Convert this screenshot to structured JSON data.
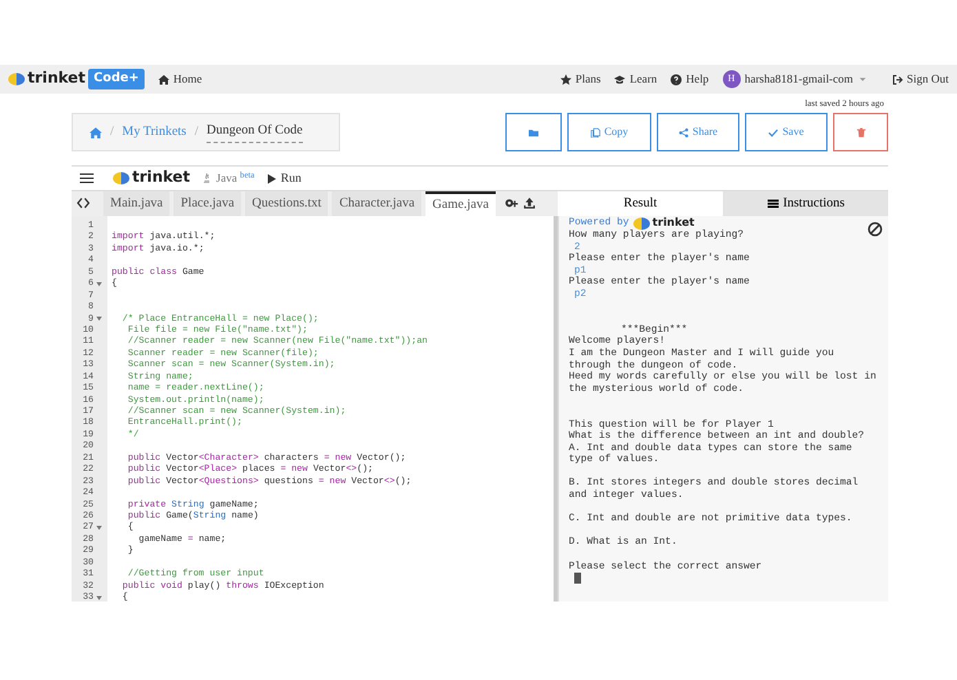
{
  "navbar": {
    "logo": "trinket",
    "badge": "Code+",
    "home": "Home",
    "items": [
      {
        "label": "Plans",
        "kind": "plans"
      },
      {
        "label": "Learn",
        "kind": "learn"
      },
      {
        "label": "Help",
        "kind": "help"
      }
    ],
    "avatar": "H",
    "user": "harsha8181-gmail-com",
    "signout": "Sign Out"
  },
  "saved": "last saved 2 hours ago",
  "breadcrumb": {
    "separators": [
      "/",
      "/"
    ],
    "link": "My Trinkets",
    "current": "Dungeon Of Code"
  },
  "actions": [
    {
      "kind": "folder"
    },
    {
      "kind": "copy",
      "label": "Copy"
    },
    {
      "kind": "share",
      "label": "Share"
    },
    {
      "kind": "save",
      "label": "Save"
    },
    {
      "kind": "delete"
    }
  ],
  "toolbar": {
    "logo": "trinket",
    "language": "Java",
    "tag": "beta",
    "run": "Run"
  },
  "files": [
    {
      "label": "Main.java",
      "selected": false
    },
    {
      "label": "Place.java",
      "selected": false
    },
    {
      "label": "Questions.txt",
      "selected": false
    },
    {
      "label": "Character.java",
      "selected": false
    },
    {
      "label": "Game.java",
      "selected": true
    }
  ],
  "panes": [
    {
      "label": "Result",
      "selected": true,
      "kind": "result"
    },
    {
      "label": "Instructions",
      "selected": false,
      "kind": "instructions"
    }
  ],
  "code": [
    {
      "n": "1",
      "fold": false
    },
    {
      "n": "2",
      "fold": false,
      "tokens": [
        {
          "kind": "keyword",
          "t": "import"
        },
        {
          "kind": "plain",
          "t": " java.util.*;"
        }
      ]
    },
    {
      "n": "3",
      "fold": false,
      "tokens": [
        {
          "kind": "keyword",
          "t": "import"
        },
        {
          "kind": "plain",
          "t": " java.io.*;"
        }
      ]
    },
    {
      "n": "4",
      "fold": false
    },
    {
      "n": "5",
      "fold": false,
      "tokens": [
        {
          "kind": "keyword",
          "t": "public class"
        },
        {
          "kind": "plain",
          "t": " Game"
        }
      ]
    },
    {
      "n": "6",
      "fold": true,
      "tokens": [
        {
          "kind": "plain",
          "t": "{"
        }
      ]
    },
    {
      "n": "7",
      "fold": false
    },
    {
      "n": "8",
      "fold": false
    },
    {
      "n": "9",
      "fold": true,
      "tokens": [
        {
          "kind": "comment",
          "t": "  /* Place EntranceHall = new Place();"
        }
      ]
    },
    {
      "n": "10",
      "fold": false,
      "tokens": [
        {
          "kind": "comment",
          "t": "   File file = new File(\"name.txt\");"
        }
      ]
    },
    {
      "n": "11",
      "fold": false,
      "tokens": [
        {
          "kind": "comment",
          "t": "   //Scanner reader = new Scanner(new File(\"name.txt\"));an"
        }
      ]
    },
    {
      "n": "12",
      "fold": false,
      "tokens": [
        {
          "kind": "comment",
          "t": "   Scanner reader = new Scanner(file);"
        }
      ]
    },
    {
      "n": "13",
      "fold": false,
      "tokens": [
        {
          "kind": "comment",
          "t": "   Scanner scan = new Scanner(System.in);"
        }
      ]
    },
    {
      "n": "14",
      "fold": false,
      "tokens": [
        {
          "kind": "comment",
          "t": "   String name;"
        }
      ]
    },
    {
      "n": "15",
      "fold": false,
      "tokens": [
        {
          "kind": "comment",
          "t": "   name = reader.nextLine();"
        }
      ]
    },
    {
      "n": "16",
      "fold": false,
      "tokens": [
        {
          "kind": "comment",
          "t": "   System.out.println(name);"
        }
      ]
    },
    {
      "n": "17",
      "fold": false,
      "tokens": [
        {
          "kind": "comment",
          "t": "   //Scanner scan = new Scanner(System.in);"
        }
      ]
    },
    {
      "n": "18",
      "fold": false,
      "tokens": [
        {
          "kind": "comment",
          "t": "   EntranceHall.print();"
        }
      ]
    },
    {
      "n": "19",
      "fold": false,
      "tokens": [
        {
          "kind": "comment",
          "t": "   */"
        }
      ]
    },
    {
      "n": "20",
      "fold": false
    },
    {
      "n": "21",
      "fold": false,
      "tokens": [
        {
          "kind": "keyword",
          "t": "   public"
        },
        {
          "kind": "plain",
          "t": " Vector"
        },
        {
          "kind": "keyword",
          "t": "<Character>"
        },
        {
          "kind": "plain",
          "t": " characters "
        },
        {
          "kind": "keyword",
          "t": "= new"
        },
        {
          "kind": "plain",
          "t": " Vector();"
        }
      ]
    },
    {
      "n": "22",
      "fold": false,
      "tokens": [
        {
          "kind": "keyword",
          "t": "   public"
        },
        {
          "kind": "plain",
          "t": " Vector"
        },
        {
          "kind": "keyword",
          "t": "<Place>"
        },
        {
          "kind": "plain",
          "t": " places "
        },
        {
          "kind": "keyword",
          "t": "= new"
        },
        {
          "kind": "plain",
          "t": " Vector"
        },
        {
          "kind": "keyword",
          "t": "<>"
        },
        {
          "kind": "plain",
          "t": "();"
        }
      ]
    },
    {
      "n": "23",
      "fold": false,
      "tokens": [
        {
          "kind": "keyword",
          "t": "   public"
        },
        {
          "kind": "plain",
          "t": " Vector"
        },
        {
          "kind": "keyword",
          "t": "<Questions>"
        },
        {
          "kind": "plain",
          "t": " questions "
        },
        {
          "kind": "keyword",
          "t": "= new"
        },
        {
          "kind": "plain",
          "t": " Vector"
        },
        {
          "kind": "keyword",
          "t": "<>"
        },
        {
          "kind": "plain",
          "t": "();"
        }
      ]
    },
    {
      "n": "24",
      "fold": false
    },
    {
      "n": "25",
      "fold": false,
      "tokens": [
        {
          "kind": "keyword",
          "t": "   private"
        },
        {
          "kind": "type",
          "t": " String"
        },
        {
          "kind": "plain",
          "t": " gameName;"
        }
      ]
    },
    {
      "n": "26",
      "fold": false,
      "tokens": [
        {
          "kind": "keyword",
          "t": "   public"
        },
        {
          "kind": "plain",
          "t": " Game("
        },
        {
          "kind": "type",
          "t": "String"
        },
        {
          "kind": "plain",
          "t": " name)"
        }
      ]
    },
    {
      "n": "27",
      "fold": true,
      "tokens": [
        {
          "kind": "plain",
          "t": "   {"
        }
      ]
    },
    {
      "n": "28",
      "fold": false,
      "tokens": [
        {
          "kind": "plain",
          "t": "     gameName "
        },
        {
          "kind": "keyword",
          "t": "="
        },
        {
          "kind": "plain",
          "t": " name;"
        }
      ]
    },
    {
      "n": "29",
      "fold": false,
      "tokens": [
        {
          "kind": "plain",
          "t": "   }"
        }
      ]
    },
    {
      "n": "30",
      "fold": false
    },
    {
      "n": "31",
      "fold": false,
      "tokens": [
        {
          "kind": "comment",
          "t": "   //Getting from user input"
        }
      ]
    },
    {
      "n": "32",
      "fold": false,
      "tokens": [
        {
          "kind": "keyword",
          "t": "  public void"
        },
        {
          "kind": "plain",
          "t": " play() "
        },
        {
          "kind": "keyword",
          "t": "throws"
        },
        {
          "kind": "plain",
          "t": " IOException"
        }
      ]
    },
    {
      "n": "33",
      "fold": true,
      "tokens": [
        {
          "kind": "plain",
          "t": "  {"
        }
      ]
    }
  ],
  "powered": {
    "text": "Powered by",
    "logo": "trinket"
  },
  "output": [
    {
      "lines": [
        {
          "kind": "out",
          "text": "How many players are playing?"
        },
        {
          "kind": "in",
          "text": "2"
        },
        {
          "kind": "out",
          "text": "Please enter the player's name"
        },
        {
          "kind": "in",
          "text": "p1"
        },
        {
          "kind": "out",
          "text": "Please enter the player's name"
        },
        {
          "kind": "in",
          "text": "p2"
        }
      ]
    },
    {
      "lines": [
        {
          "kind": "title",
          "text": "***Begin***"
        },
        {
          "kind": "out",
          "text": "Welcome players!"
        },
        {
          "kind": "out",
          "text": "I am the Dungeon Master and I will guide you"
        },
        {
          "kind": "out",
          "text": "through the dungeon of code."
        },
        {
          "kind": "out",
          "text": "Heed my words carefully or else you will be lost in"
        },
        {
          "kind": "out",
          "text": "the mysterious world of code."
        }
      ]
    },
    {
      "lines": [
        {
          "kind": "out",
          "text": "This question will be for Player 1"
        },
        {
          "kind": "out",
          "text": "What is the difference between an int and double?"
        },
        {
          "kind": "out",
          "text": "A. Int and double data types can store the same"
        },
        {
          "kind": "out",
          "text": "type of values."
        }
      ]
    },
    {
      "lines": [
        {
          "kind": "out",
          "text": "B. Int stores integers and double stores decimal"
        },
        {
          "kind": "out",
          "text": "and integer values."
        }
      ]
    },
    {
      "lines": [
        {
          "kind": "out",
          "text": "C. Int and double are not primitive data types."
        }
      ]
    },
    {
      "lines": [
        {
          "kind": "out",
          "text": "D. What is an Int."
        }
      ]
    },
    {
      "lines": [
        {
          "kind": "out",
          "text": "Please select the correct answer"
        }
      ]
    }
  ]
}
